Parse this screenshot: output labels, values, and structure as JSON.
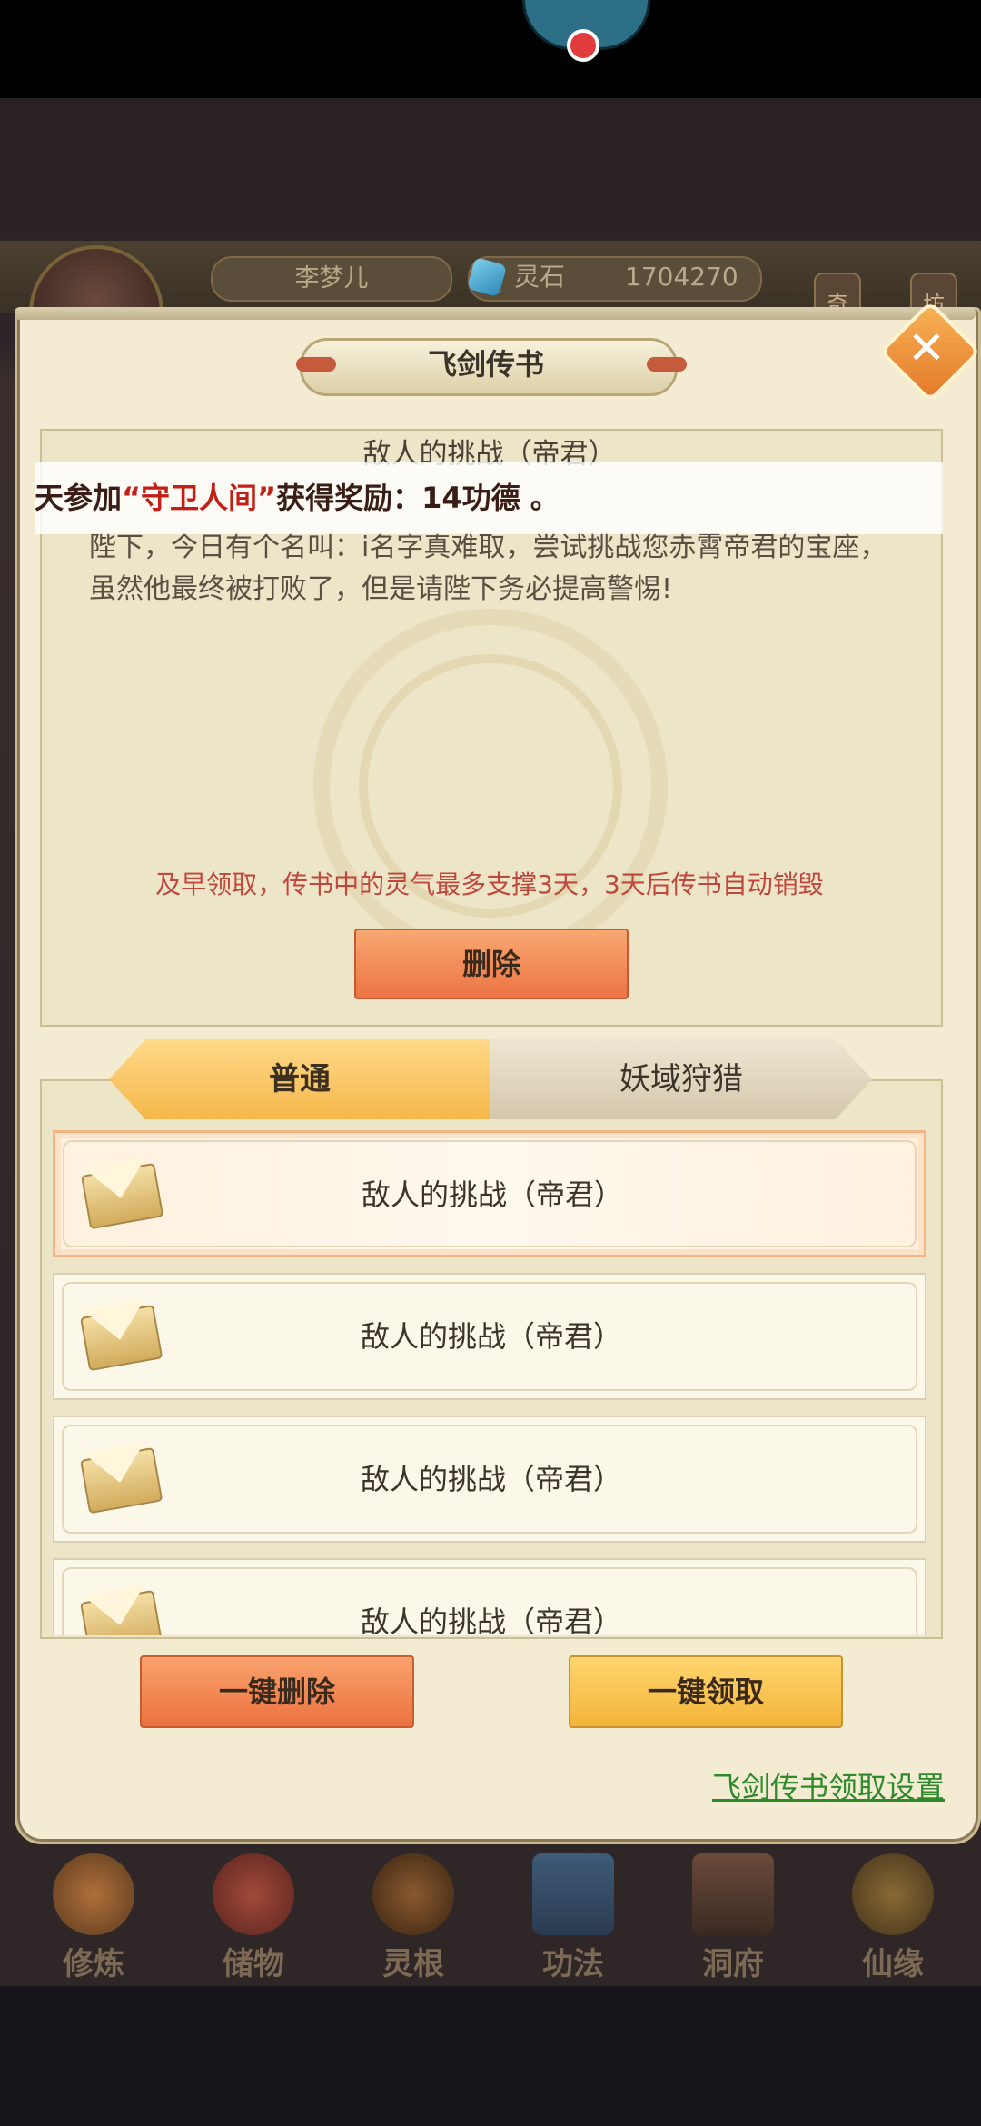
{
  "status": {
    "indicator": "red-dot"
  },
  "player": {
    "name": "李梦儿",
    "spirit_stone_label": "灵石",
    "spirit_stone_value": "1704270",
    "side_tags": [
      "奇",
      "坊"
    ]
  },
  "modal": {
    "title": "飞剑传书",
    "close_label": "✕"
  },
  "detail": {
    "subject": "敌人的挑战（帝君）",
    "body": "陛下，今日有个名叫：i名字真难取，尝试挑战您赤霄帝君的宝座，虽然他最终被打败了，但是请陛下务必提高警惕!",
    "notice": "及早领取，传书中的灵气最多支撑3天，3天后传书自动销毁",
    "delete_label": "删除"
  },
  "tabs": [
    {
      "label": "普通",
      "active": true
    },
    {
      "label": "妖域狩猎",
      "active": false
    }
  ],
  "mails": [
    {
      "title": "敌人的挑战（帝君）",
      "selected": true
    },
    {
      "title": "敌人的挑战（帝君）",
      "selected": false
    },
    {
      "title": "敌人的挑战（帝君）",
      "selected": false
    },
    {
      "title": "敌人的挑战（帝君）",
      "selected": false
    }
  ],
  "actions": {
    "delete_all": "一键删除",
    "claim_all": "一键领取",
    "settings_link": "飞剑传书领取设置"
  },
  "marquee": {
    "prefix": "天参加",
    "highlight": "“守卫人间”",
    "suffix": "获得奖励：14功德 。"
  },
  "nav": [
    "修炼",
    "储物",
    "灵根",
    "功法",
    "洞府",
    "仙缘"
  ],
  "colors": {
    "notice_red": "#c0473c",
    "link_green": "#2f8a2b",
    "primary_orange": "#ec7444",
    "primary_gold": "#f3b43a"
  }
}
